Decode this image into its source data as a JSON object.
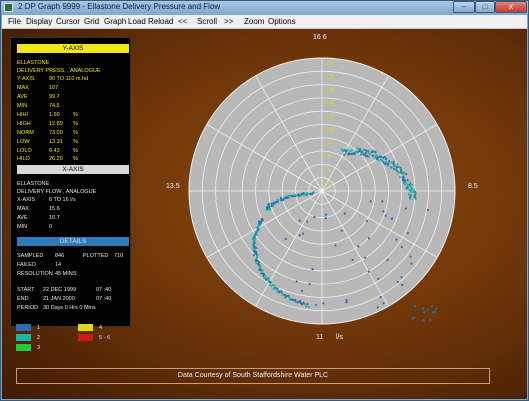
{
  "window": {
    "title": "2  DP Graph 9999 - Ellastone Delivery Pressure and Flow"
  },
  "titlebar_buttons": {
    "minimize": "–",
    "maximize": "□",
    "close": "x"
  },
  "menu": [
    "File",
    "Display",
    "Cursor",
    "Grid",
    "Graph",
    "Load",
    "Reload",
    "<<",
    "Scroll",
    ">>",
    "Zoom",
    "Options"
  ],
  "y_axis": {
    "header": "Y-AXIS",
    "site": "ELLASTONE",
    "measure": "DELIVERY PRESS.  ,  ANALOGUE",
    "range_label": "Y-AXIS",
    "range": "90  TO  110  m.hd",
    "stats": [
      {
        "label": "MAX",
        "value": "107",
        "unit": ""
      },
      {
        "label": "AVE",
        "value": "99.7",
        "unit": ""
      },
      {
        "label": "MIN",
        "value": "74.5",
        "unit": ""
      },
      {
        "label": "HIHI",
        "value": "1.60",
        "unit": "%"
      },
      {
        "label": "HIGH",
        "value": "12.89",
        "unit": "%"
      },
      {
        "label": "NORM",
        "value": "73.00",
        "unit": "%"
      },
      {
        "label": "LOW",
        "value": "13.31",
        "unit": "%"
      },
      {
        "label": "LOLO",
        "value": "0.43",
        "unit": "%"
      },
      {
        "label": "HILO",
        "value": "26.20",
        "unit": "%"
      }
    ]
  },
  "x_axis": {
    "header": "X-AXIS",
    "site": "ELLASTONE",
    "measure": "DELIVERY FLOW  ,  ANALOGUE",
    "range_label": "X-AXIS",
    "range": "6  TO  16  l/s",
    "stats": [
      {
        "label": "MAX",
        "value": "15.6"
      },
      {
        "label": "AVE",
        "value": "10.7"
      },
      {
        "label": "MIN",
        "value": "0"
      }
    ]
  },
  "details": {
    "header": "DETAILS",
    "sampled_label": "SAMPLED",
    "sampled": "846",
    "plotted_label": "PLOTTED",
    "plotted": "710",
    "failed_label": "FAILED",
    "failed": "14",
    "resolution_label": "RESOLUTION",
    "resolution": "45  MINS",
    "start_label": "START",
    "start_date": "22  DEC  1999",
    "start_time": "07 :40",
    "end_label": "END",
    "end_date": "21  JAN  2000",
    "end_time": "07 :40",
    "period_label": "PERIOD",
    "period": "30  Days  0  Hrs  0  Mins"
  },
  "legend": [
    {
      "label": "1",
      "color": "#2c6db0"
    },
    {
      "label": "2",
      "color": "#16b8a6"
    },
    {
      "label": "3",
      "color": "#1ecf3a"
    },
    {
      "label": "4",
      "color": "#e0d818"
    },
    {
      "label": "5 - 6",
      "color": "#d01818"
    }
  ],
  "polar": {
    "top": "16  6",
    "left": "13.5",
    "right": "8.5",
    "bottom": "11",
    "bottom_unit": "l/s",
    "ring_labels": [
      "110",
      "108",
      "106",
      "104",
      "102",
      "100",
      "98",
      "96",
      "94",
      "92"
    ],
    "ring_color": "#f0f0f0",
    "face_color": "#b8b8b8"
  },
  "footer": "Data Courtesy of South Staffordshire Water PLC"
}
